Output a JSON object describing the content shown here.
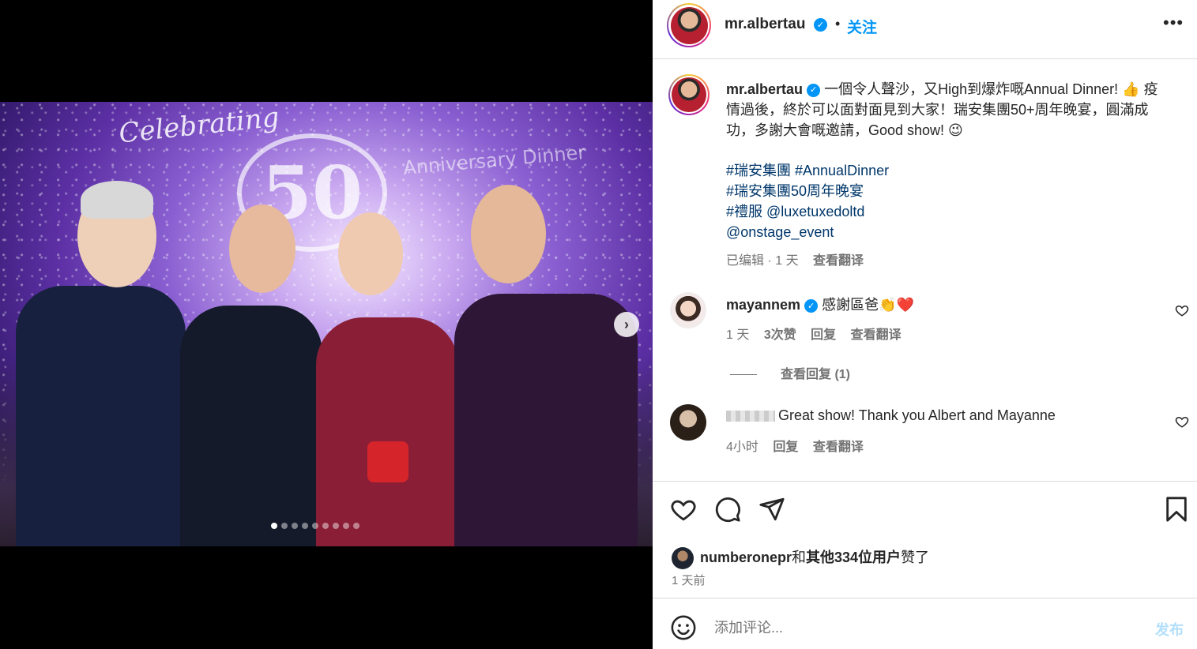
{
  "header": {
    "username": "mr.albertau",
    "separator": "•",
    "follow_label": "关注",
    "more_label": "•••"
  },
  "caption": {
    "username": "mr.albertau",
    "text": "一個令人聲沙，又High到爆炸嘅Annual Dinner! 👍 疫情過後，終於可以面對面見到大家！瑞安集團50+周年晚宴，圓滿成功，多謝大會嘅邀請，Good show! 😉",
    "hashtags": [
      "#瑞安集團 #AnnualDinner",
      "#瑞安集團50周年晚宴",
      "#禮服 @luxetuxedoltd",
      "@onstage_event"
    ],
    "edited": "已编辑 · 1 天",
    "see_translation": "查看翻译"
  },
  "comments": [
    {
      "username": "mayannem",
      "text": "感謝區爸👏❤️",
      "time": "1 天",
      "likes": "3次赞",
      "reply": "回复",
      "translate": "查看翻译",
      "view_replies": "查看回复 (1)"
    },
    {
      "text": "Great show! Thank you Albert and Mayanne",
      "time": "4小时",
      "reply": "回复",
      "translate": "查看翻译"
    }
  ],
  "likes": {
    "user": "numberonepr",
    "connector": "和",
    "others": "其他334位用户",
    "suffix": "赞了"
  },
  "timestamp": "1 天前",
  "comment_box": {
    "placeholder": "添加评论...",
    "post_label": "发布"
  },
  "photo": {
    "celebrating": "Celebrating",
    "number": "50",
    "anniversary": "Anniversary Dinner",
    "next_icon": "›",
    "slide_count": 9,
    "active_slide": 1
  },
  "colors": {
    "accent": "#0095f6",
    "link": "#00376b",
    "muted": "#737373"
  }
}
